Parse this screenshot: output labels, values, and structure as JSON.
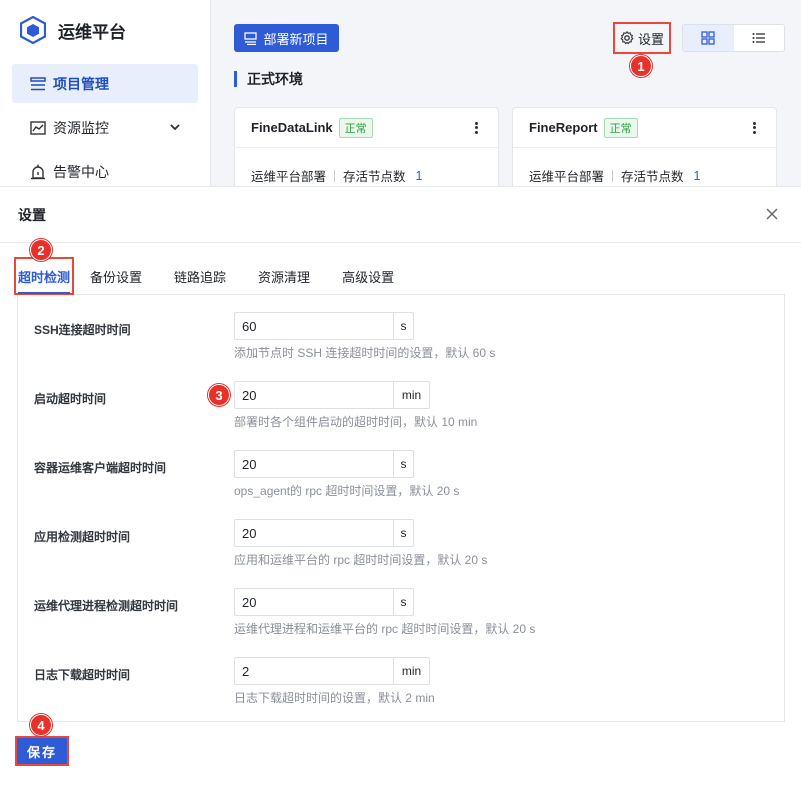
{
  "app": {
    "name": "运维平台"
  },
  "sidebar": {
    "items": [
      {
        "label": "项目管理",
        "icon": "server-list-icon",
        "active": true
      },
      {
        "label": "资源监控",
        "icon": "monitor-chart-icon",
        "active": false
      },
      {
        "label": "告警中心",
        "icon": "alarm-bell-icon",
        "active": false
      }
    ]
  },
  "toolbar": {
    "deploy_label": "部署新项目",
    "settings_label": "设置"
  },
  "section": {
    "title": "正式环境"
  },
  "cards": [
    {
      "name": "FineDataLink",
      "status": "正常",
      "deploy": "运维平台部署",
      "nodes_label": "存活节点数",
      "nodes": "1"
    },
    {
      "name": "FineReport",
      "status": "正常",
      "deploy": "运维平台部署",
      "nodes_label": "存活节点数",
      "nodes": "1"
    }
  ],
  "modal": {
    "title": "设置",
    "tabs": [
      "超时检测",
      "备份设置",
      "链路追踪",
      "资源清理",
      "高级设置"
    ],
    "fields": [
      {
        "label": "SSH连接超时时间",
        "value": "60",
        "unit": "s",
        "hint": "添加节点时 SSH 连接超时时间的设置，默认 60 s"
      },
      {
        "label": "启动超时时间",
        "value": "20",
        "unit": "min",
        "hint": "部署时各个组件启动的超时时间，默认 10 min"
      },
      {
        "label": "容器运维客户端超时时间",
        "value": "20",
        "unit": "s",
        "hint": "ops_agent的 rpc 超时时间设置，默认 20 s"
      },
      {
        "label": "应用检测超时时间",
        "value": "20",
        "unit": "s",
        "hint": "应用和运维平台的 rpc 超时时间设置，默认 20 s"
      },
      {
        "label": "运维代理进程检测超时时间",
        "value": "20",
        "unit": "s",
        "hint": "运维代理进程和运维平台的 rpc 超时时间设置，默认 20 s"
      },
      {
        "label": "日志下载超时时间",
        "value": "2",
        "unit": "min",
        "hint": "日志下载超时时间的设置，默认 2 min"
      }
    ],
    "save_label": "保存"
  },
  "markers": [
    "1",
    "2",
    "3",
    "4"
  ],
  "colors": {
    "primary": "#2e5cd6",
    "annotation": "#e8473c",
    "success": "#2f9e44"
  }
}
